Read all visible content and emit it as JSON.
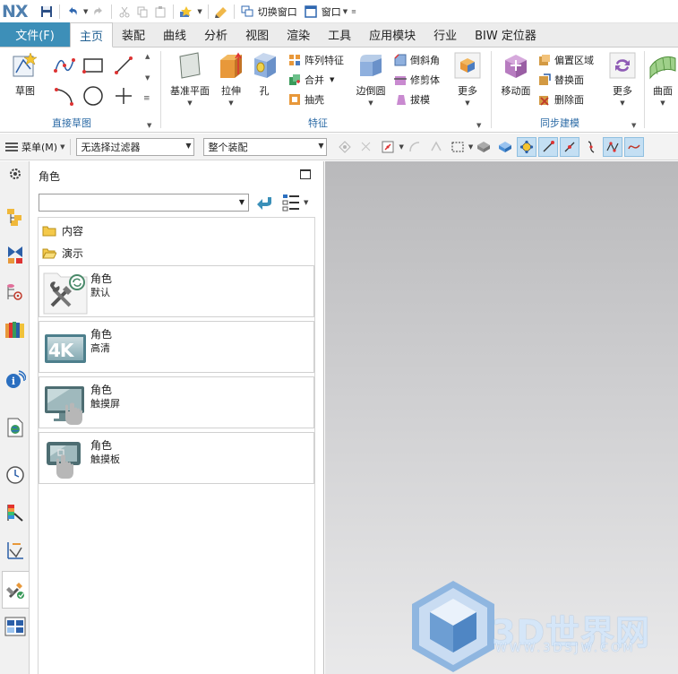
{
  "app": {
    "logo": "NX",
    "quick_access": {
      "switch_window_label": "切换窗口",
      "window_label": "窗口"
    }
  },
  "tabs": {
    "file": "文件(F)",
    "items": [
      "主页",
      "装配",
      "曲线",
      "分析",
      "视图",
      "渲染",
      "工具",
      "应用模块",
      "行业",
      "BIW 定位器"
    ],
    "active_index": 0
  },
  "ribbon": {
    "groups": {
      "direct_sketch": {
        "label": "直接草图",
        "sketch_button": "草图"
      },
      "feature": {
        "label": "特征",
        "datum_plane": "基准平面",
        "extrude": "拉伸",
        "hole": "孔",
        "pattern_feature": "阵列特征",
        "unite": "合并",
        "shell": "抽壳",
        "edge_blend": "边倒圆",
        "chamfer": "倒斜角",
        "trim_body": "修剪体",
        "draft": "拔模",
        "more": "更多"
      },
      "sync_modeling": {
        "label": "同步建模",
        "move_face": "移动面",
        "offset_region": "偏置区域",
        "replace_face": "替换面",
        "delete_face": "删除面",
        "more": "更多"
      },
      "surface": {
        "surface": "曲面"
      }
    }
  },
  "toolbar2": {
    "menu_label": "菜单(M)",
    "filter_value": "无选择过滤器",
    "scope_value": "整个装配"
  },
  "roles_panel": {
    "title": "角色",
    "search_value": "",
    "folders": [
      "内容",
      "演示"
    ],
    "cards": [
      {
        "title": "角色",
        "subtitle": "默认",
        "icon": "tools-icon"
      },
      {
        "title": "角色",
        "subtitle": "高清",
        "icon": "4k-monitor-icon"
      },
      {
        "title": "角色",
        "subtitle": "触摸屏",
        "icon": "touch-screen-icon"
      },
      {
        "title": "角色",
        "subtitle": "触摸板",
        "icon": "touch-pad-icon"
      }
    ],
    "card_badge": "4K"
  },
  "watermark": {
    "brand": "3D世界网",
    "url": "WWW.3DSJW.COM"
  },
  "colors": {
    "file_tab": "#3d8fb8",
    "group_label": "#2b6aa5",
    "highlight": "#c4dff3",
    "graphics_top": "#b9b9bb",
    "graphics_bottom": "#e9e9ea"
  }
}
